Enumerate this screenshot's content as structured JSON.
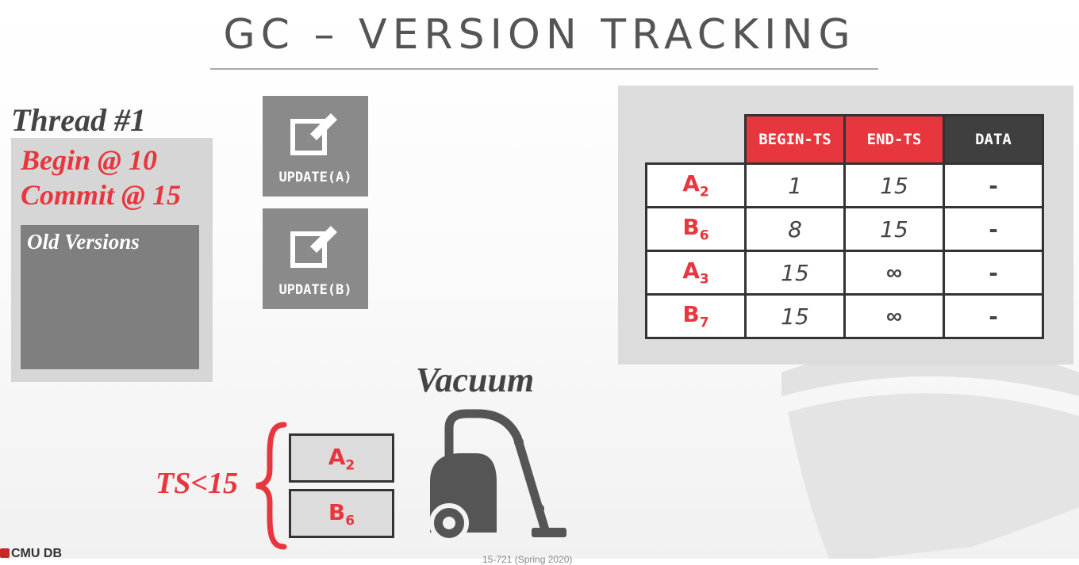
{
  "slide": {
    "title": "GC – VERSION TRACKING"
  },
  "thread": {
    "label": "Thread #1",
    "begin": "Begin @ 10",
    "commit": "Commit @ 15",
    "old_versions": "Old Versions"
  },
  "operations": [
    {
      "label": "UPDATE(A)",
      "icon": "edit-icon"
    },
    {
      "label": "UPDATE(B)",
      "icon": "edit-icon"
    }
  ],
  "version_table": {
    "headers": [
      "BEGIN-TS",
      "END-TS",
      "DATA"
    ],
    "rows": [
      {
        "name": "A",
        "sub": "2",
        "begin": "1",
        "end": "15",
        "data": "-"
      },
      {
        "name": "B",
        "sub": "6",
        "begin": "8",
        "end": "15",
        "data": "-"
      },
      {
        "name": "A",
        "sub": "3",
        "begin": "15",
        "end": "∞",
        "data": "-"
      },
      {
        "name": "B",
        "sub": "7",
        "begin": "15",
        "end": "∞",
        "data": "-"
      }
    ]
  },
  "vacuum": {
    "label": "Vacuum",
    "condition": "TS<15",
    "items": [
      {
        "name": "A",
        "sub": "2"
      },
      {
        "name": "B",
        "sub": "6"
      }
    ],
    "icon": "vacuum-cleaner-icon"
  },
  "footer": {
    "logo": "CMU DB",
    "course": "15-721 (Spring 2020)"
  },
  "colors": {
    "accent": "#e8363e",
    "dark": "#3f3f3f",
    "panel": "#dcdcdc"
  }
}
